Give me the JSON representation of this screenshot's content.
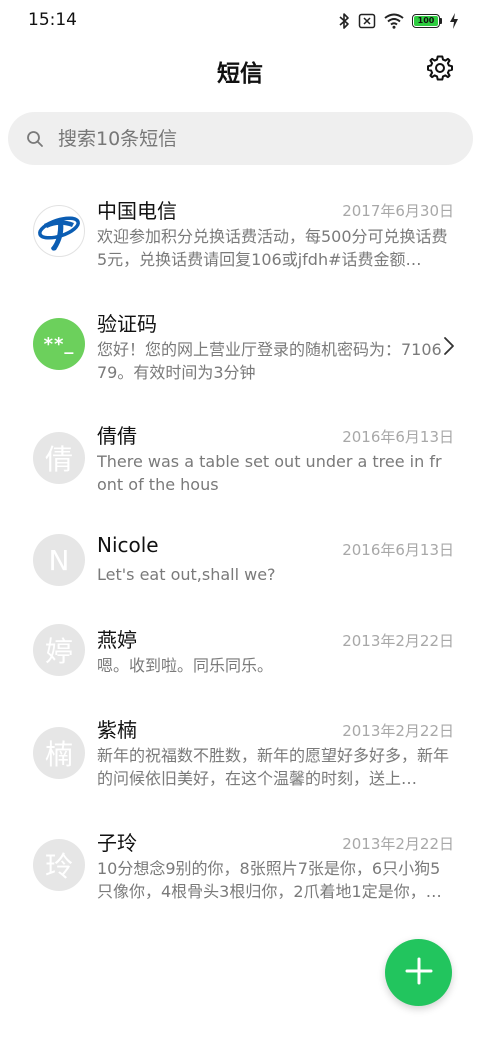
{
  "status_bar": {
    "time": "15:14",
    "battery_level": "100",
    "icons": [
      "bluetooth-icon",
      "no-sim-icon",
      "wifi-icon",
      "battery-icon",
      "charging-icon"
    ]
  },
  "header": {
    "title": "短信",
    "settings_icon": "gear-icon"
  },
  "search": {
    "placeholder": "搜索10条短信",
    "icon": "search-icon"
  },
  "conversations": [
    {
      "name": "中国电信",
      "date": "2017年6月30日",
      "snippet": "欢迎参加积分兑换话费活动，每500分可兑换话费5元，兑换话费请回复106或jfdh#话费金额…",
      "avatar_type": "china-telecom-logo"
    },
    {
      "name": "验证码",
      "date": "",
      "snippet": "您好！您的网上营业厅登录的随机密码为：710679。有效时间为3分钟",
      "avatar_text": "**_",
      "avatar_color": "#6cd05c"
    },
    {
      "name": "倩倩",
      "date": "2016年6月13日",
      "snippet": "There was a table set out under a tree in front of the hous",
      "avatar_text": "倩"
    },
    {
      "name": "Nicole",
      "date": "2016年6月13日",
      "snippet": "Let's eat out,shall we?",
      "avatar_text": "N"
    },
    {
      "name": "燕婷",
      "date": "2013年2月22日",
      "snippet": "嗯。收到啦。同乐同乐。",
      "avatar_text": "婷"
    },
    {
      "name": "紫楠",
      "date": "2013年2月22日",
      "snippet": "新年的祝福数不胜数，新年的愿望好多好多，新年的问候依旧美好，在这个温馨的时刻，送上…",
      "avatar_text": "楠"
    },
    {
      "name": "子玲",
      "date": "2013年2月22日",
      "snippet": "10分想念9别的你，8张照片7张是你，6只小狗5只像你，4根骨头3根归你，2爪着地1定是你，…",
      "avatar_text": "玲"
    }
  ],
  "fab": {
    "icon": "plus-icon",
    "color": "#22c55e"
  }
}
